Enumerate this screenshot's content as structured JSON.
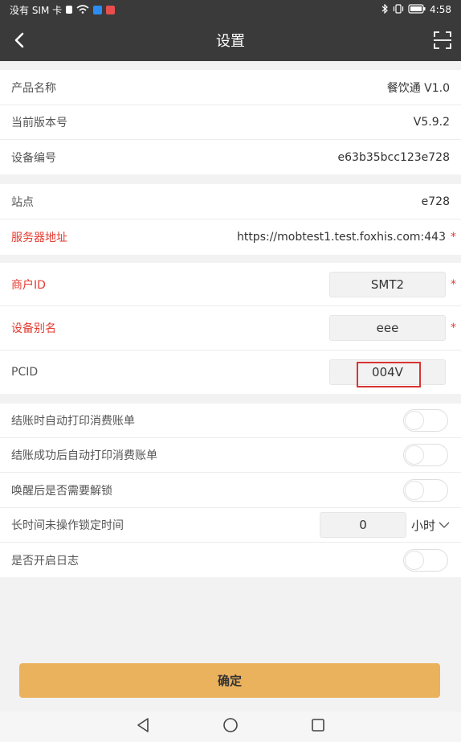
{
  "status_bar": {
    "carrier_text": "没有 SIM 卡",
    "time": "4:58",
    "icons": [
      "sim-icon",
      "wifi-icon",
      "app-notification-icon",
      "bluetooth-icon",
      "vibrate-icon",
      "battery-icon"
    ]
  },
  "header": {
    "title": "设置",
    "back_icon": "back-arrow-icon",
    "scan_icon": "scan-icon"
  },
  "info": [
    {
      "label": "产品名称",
      "value": "餐饮通 V1.0"
    },
    {
      "label": "当前版本号",
      "value": "V5.9.2"
    },
    {
      "label": "设备编号",
      "value": "e63b35bcc123e728"
    }
  ],
  "server": [
    {
      "label": "站点",
      "value": "e728",
      "required": false
    },
    {
      "label": "服务器地址",
      "value": "https://mobtest1.test.foxhis.com:443",
      "required": true
    }
  ],
  "merchant": [
    {
      "label": "商户ID",
      "value": "SMT2",
      "required": true
    },
    {
      "label": "设备别名",
      "value": "eee",
      "required": true
    },
    {
      "label": "PCID",
      "value": "004V",
      "required": false
    }
  ],
  "required_mark": "*",
  "options": [
    {
      "label": "结账时自动打印消费账单",
      "on": false
    },
    {
      "label": "结账成功后自动打印消费账单",
      "on": false
    },
    {
      "label": "唤醒后是否需要解锁",
      "on": false
    },
    {
      "label": "长时间未操作锁定时间",
      "value": "0",
      "unit": "小时"
    },
    {
      "label": "是否开启日志",
      "on": false
    }
  ],
  "confirm_label": "确定",
  "colors": {
    "header_bg": "#3a3a3a",
    "required": "#e43b30",
    "confirm_bg": "#ebb25d",
    "highlight_box": "#d93434"
  }
}
